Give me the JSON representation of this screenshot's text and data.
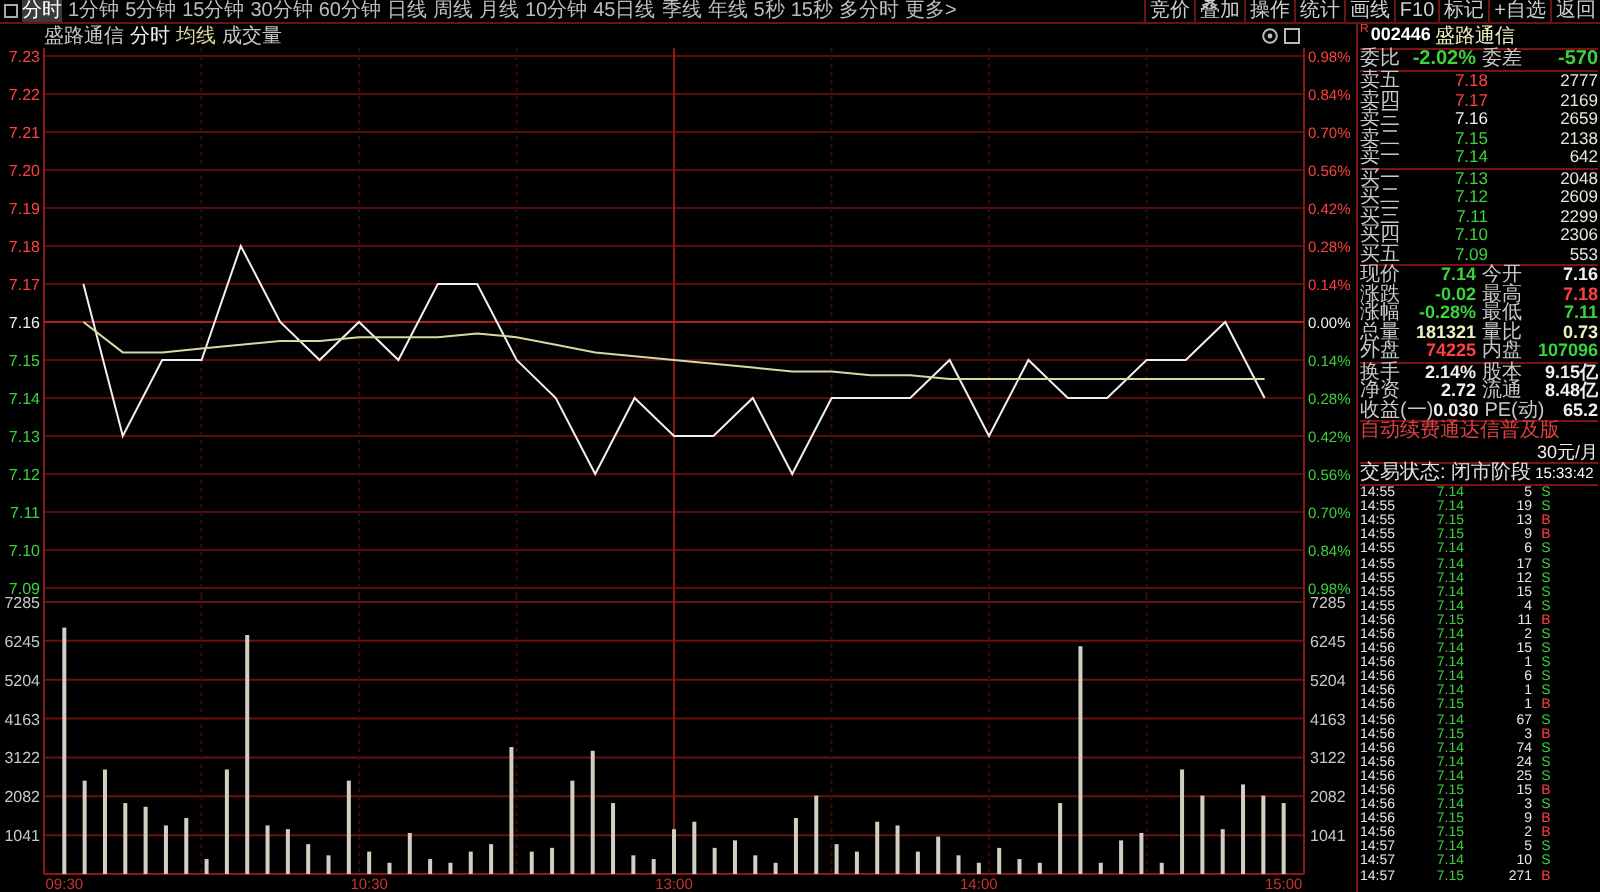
{
  "toolbar": {
    "periods": [
      {
        "label": "分时",
        "selected": true
      },
      {
        "label": "1分钟",
        "selected": false
      },
      {
        "label": "5分钟",
        "selected": false
      },
      {
        "label": "15分钟",
        "selected": false
      },
      {
        "label": "30分钟",
        "selected": false
      },
      {
        "label": "60分钟",
        "selected": false
      },
      {
        "label": "日线",
        "selected": false
      },
      {
        "label": "周线",
        "selected": false
      },
      {
        "label": "月线",
        "selected": false
      },
      {
        "label": "10分钟",
        "selected": false
      },
      {
        "label": "45日线",
        "selected": false
      },
      {
        "label": "季线",
        "selected": false
      },
      {
        "label": "年线",
        "selected": false
      },
      {
        "label": "5秒",
        "selected": false
      },
      {
        "label": "15秒",
        "selected": false
      },
      {
        "label": "多分时",
        "selected": false
      },
      {
        "label": "更多>",
        "selected": false
      }
    ],
    "actions": [
      "竞价",
      "叠加",
      "操作",
      "统计",
      "画线",
      "F10",
      "标记",
      "+自选",
      "返回"
    ]
  },
  "price_pane": {
    "title": "盛路通信",
    "percent_labels": [
      {
        "text": "0.98%",
        "kind": "up"
      },
      {
        "text": "0.84%",
        "kind": "up"
      },
      {
        "text": "0.70%",
        "kind": "up"
      },
      {
        "text": "0.56%",
        "kind": "up"
      },
      {
        "text": "0.42%",
        "kind": "up"
      },
      {
        "text": "0.28%",
        "kind": "up"
      },
      {
        "text": "0.14%",
        "kind": "up"
      },
      {
        "text": "0.00%",
        "kind": "flat"
      },
      {
        "text": "0.14%",
        "kind": "down"
      },
      {
        "text": "0.28%",
        "kind": "down"
      },
      {
        "text": "0.42%",
        "kind": "down"
      },
      {
        "text": "0.56%",
        "kind": "down"
      },
      {
        "text": "0.70%",
        "kind": "down"
      },
      {
        "text": "0.84%",
        "kind": "down"
      },
      {
        "text": "0.98%",
        "kind": "down"
      }
    ],
    "chart_data": {
      "type": "line",
      "grid": true,
      "categories": [
        null,
        null,
        null,
        null,
        null,
        null,
        null,
        null,
        null,
        null,
        null,
        null,
        null,
        null,
        null,
        null,
        null,
        null,
        null,
        null,
        null,
        null,
        null,
        null,
        null,
        null,
        null,
        null,
        null,
        null,
        null
      ],
      "ref_lines": [
        {
          "axis": "y",
          "value": 7.16
        }
      ],
      "series": [
        {
          "name": "分时",
          "color": "#f0f0f0",
          "values": [
            7.17,
            7.13,
            7.15,
            7.15,
            7.18,
            7.16,
            7.15,
            7.16,
            7.15,
            7.17,
            7.17,
            7.15,
            7.14,
            7.12,
            7.14,
            7.13,
            7.13,
            7.14,
            7.12,
            7.14,
            7.14,
            7.14,
            7.15,
            7.13,
            7.15,
            7.14,
            7.14,
            7.15,
            7.15,
            7.16,
            7.14
          ]
        },
        {
          "name": "均线",
          "color": "#d8d8a0",
          "values": [
            7.16,
            7.152,
            7.152,
            7.153,
            7.154,
            7.155,
            7.155,
            7.156,
            7.156,
            7.156,
            7.157,
            7.156,
            7.154,
            7.152,
            7.151,
            7.15,
            7.149,
            7.148,
            7.147,
            7.147,
            7.146,
            7.146,
            7.145,
            7.145,
            7.145,
            7.145,
            7.145,
            7.145,
            7.145,
            7.145,
            7.145
          ]
        }
      ],
      "ylim": [
        7.09,
        7.23
      ],
      "yticks": [
        {
          "value": 7.23,
          "label": "7.23"
        },
        {
          "value": 7.22,
          "label": "7.22"
        },
        {
          "value": 7.21,
          "label": "7.21"
        },
        {
          "value": 7.2,
          "label": "7.20"
        },
        {
          "value": 7.19,
          "label": "7.19"
        },
        {
          "value": 7.18,
          "label": "7.18"
        },
        {
          "value": 7.17,
          "label": "7.17"
        },
        {
          "value": 7.16,
          "label": "7.16"
        },
        {
          "value": 7.15,
          "label": "7.15"
        },
        {
          "value": 7.14,
          "label": "7.14"
        },
        {
          "value": 7.13,
          "label": "7.13"
        },
        {
          "value": 7.12,
          "label": "7.12"
        },
        {
          "value": 7.11,
          "label": "7.11"
        },
        {
          "value": 7.1,
          "label": "7.10"
        },
        {
          "value": 7.09,
          "label": "7.09"
        }
      ]
    }
  },
  "volume_pane": {
    "right_labels": [
      "7285",
      "6245",
      "5204",
      "4163",
      "3122",
      "2082",
      "1041"
    ],
    "chart_data": {
      "type": "bar",
      "grid": true,
      "categories": [
        "09:30",
        null,
        null,
        null,
        null,
        null,
        null,
        null,
        null,
        null,
        null,
        null,
        null,
        null,
        null,
        "10:30",
        null,
        null,
        null,
        null,
        null,
        null,
        null,
        null,
        null,
        null,
        null,
        null,
        null,
        null,
        "13:00",
        null,
        null,
        null,
        null,
        null,
        null,
        null,
        null,
        null,
        null,
        null,
        null,
        null,
        null,
        "14:00",
        null,
        null,
        null,
        null,
        null,
        null,
        null,
        null,
        null,
        null,
        null,
        null,
        null,
        null,
        "15:00"
      ],
      "series": [
        {
          "name": "成交量",
          "color": "#d0d0c0",
          "values": [
            6600,
            2500,
            2800,
            1900,
            1800,
            1300,
            1500,
            400,
            2800,
            6400,
            1300,
            1200,
            800,
            500,
            2500,
            600,
            300,
            1100,
            400,
            300,
            600,
            800,
            3400,
            600,
            700,
            2500,
            3300,
            1900,
            500,
            400,
            1200,
            1400,
            700,
            900,
            500,
            300,
            1500,
            2100,
            800,
            600,
            1400,
            1300,
            600,
            1000,
            500,
            300,
            700,
            400,
            300,
            1900,
            6100,
            300,
            900,
            1100,
            300,
            2800,
            2100,
            1200,
            2400,
            2100,
            1900
          ]
        }
      ],
      "ylim": [
        0,
        7285
      ],
      "yticks": [
        {
          "value": 7285,
          "label": "7285"
        },
        {
          "value": 6245,
          "label": "6245"
        },
        {
          "value": 5204,
          "label": "5204"
        },
        {
          "value": 4163,
          "label": "4163"
        },
        {
          "value": 3122,
          "label": "3122"
        },
        {
          "value": 2082,
          "label": "2082"
        },
        {
          "value": 1041,
          "label": "1041"
        }
      ]
    }
  },
  "quote": {
    "badge": "R",
    "code": "002446",
    "name": "盛路通信",
    "summary": [
      {
        "label": "委比",
        "value": "-2.02%"
      },
      {
        "label": "委差",
        "value": "-570"
      }
    ],
    "asks": [
      {
        "label": "卖五",
        "price": "7.18",
        "volume": "2777",
        "color": "#ff4040"
      },
      {
        "label": "卖四",
        "price": "7.17",
        "volume": "2169",
        "color": "#ff4040"
      },
      {
        "label": "卖三",
        "price": "7.16",
        "volume": "2659",
        "color": "#f0f0f0"
      },
      {
        "label": "卖二",
        "price": "7.15",
        "volume": "2138",
        "color": "#3cd23c"
      },
      {
        "label": "卖一",
        "price": "7.14",
        "volume": "642",
        "color": "#3cd23c"
      }
    ],
    "bids": [
      {
        "label": "买一",
        "price": "7.13",
        "volume": "2048",
        "color": "#3cd23c"
      },
      {
        "label": "买二",
        "price": "7.12",
        "volume": "2609",
        "color": "#3cd23c"
      },
      {
        "label": "买三",
        "price": "7.11",
        "volume": "2299",
        "color": "#3cd23c"
      },
      {
        "label": "买四",
        "price": "7.10",
        "volume": "2306",
        "color": "#3cd23c"
      },
      {
        "label": "买五",
        "price": "7.09",
        "volume": "553",
        "color": "#3cd23c"
      }
    ],
    "stats": [
      [
        {
          "label": "现价",
          "value": "7.14",
          "color": "#3cd23c"
        },
        {
          "label": "今开",
          "value": "7.16",
          "color": "#f0f0f0"
        }
      ],
      [
        {
          "label": "涨跌",
          "value": "-0.02",
          "color": "#3cd23c"
        },
        {
          "label": "最高",
          "value": "7.18",
          "color": "#ff4040"
        }
      ],
      [
        {
          "label": "涨幅",
          "value": "-0.28%",
          "color": "#3cd23c"
        },
        {
          "label": "最低",
          "value": "7.11",
          "color": "#3cd23c"
        }
      ],
      [
        {
          "label": "总量",
          "value": "181321",
          "color": "#f0f0c0"
        },
        {
          "label": "量比",
          "value": "0.73",
          "color": "#f0f0c0"
        }
      ],
      [
        {
          "label": "外盘",
          "value": "74225",
          "color": "#ff4040"
        },
        {
          "label": "内盘",
          "value": "107096",
          "color": "#3cd23c"
        }
      ]
    ],
    "fundamentals": [
      [
        {
          "label": "换手",
          "value": "2.14%",
          "color": "#f0f0f0"
        },
        {
          "label": "股本",
          "value": "9.15亿",
          "color": "#f0f0f0"
        }
      ],
      [
        {
          "label": "净资",
          "value": "2.72",
          "color": "#f0f0f0"
        },
        {
          "label": "流通",
          "value": "8.48亿",
          "color": "#f0f0f0"
        }
      ],
      [
        {
          "label": "收益(一)",
          "value": "0.030",
          "color": "#f0f0f0"
        },
        {
          "label": "PE(动)",
          "value": "65.2",
          "color": "#f0f0f0"
        }
      ]
    ],
    "promo": {
      "text": "自动续费通达信普及版",
      "price": "30元/月"
    },
    "status": {
      "label": "交易状态: 闭市阶段",
      "time": "15:33:42"
    },
    "trades": [
      {
        "time": "14:55",
        "price": "7.14",
        "volume": "5",
        "side": "S",
        "kind": "sell"
      },
      {
        "time": "14:55",
        "price": "7.14",
        "volume": "19",
        "side": "S",
        "kind": "sell"
      },
      {
        "time": "14:55",
        "price": "7.15",
        "volume": "13",
        "side": "B",
        "kind": "buy"
      },
      {
        "time": "14:55",
        "price": "7.15",
        "volume": "9",
        "side": "B",
        "kind": "buy"
      },
      {
        "time": "14:55",
        "price": "7.14",
        "volume": "6",
        "side": "S",
        "kind": "sell"
      },
      {
        "time": "14:55",
        "price": "7.14",
        "volume": "17",
        "side": "S",
        "kind": "sell"
      },
      {
        "time": "14:55",
        "price": "7.14",
        "volume": "12",
        "side": "S",
        "kind": "sell"
      },
      {
        "time": "14:55",
        "price": "7.14",
        "volume": "15",
        "side": "S",
        "kind": "sell"
      },
      {
        "time": "14:55",
        "price": "7.14",
        "volume": "4",
        "side": "S",
        "kind": "sell"
      },
      {
        "time": "14:56",
        "price": "7.15",
        "volume": "11",
        "side": "B",
        "kind": "buy"
      },
      {
        "time": "14:56",
        "price": "7.14",
        "volume": "2",
        "side": "S",
        "kind": "sell"
      },
      {
        "time": "14:56",
        "price": "7.14",
        "volume": "15",
        "side": "S",
        "kind": "sell"
      },
      {
        "time": "14:56",
        "price": "7.14",
        "volume": "1",
        "side": "S",
        "kind": "sell"
      },
      {
        "time": "14:56",
        "price": "7.14",
        "volume": "6",
        "side": "S",
        "kind": "sell"
      },
      {
        "time": "14:56",
        "price": "7.14",
        "volume": "1",
        "side": "S",
        "kind": "sell"
      },
      {
        "time": "14:56",
        "price": "7.15",
        "volume": "1",
        "side": "B",
        "kind": "buy"
      },
      {
        "time": "14:56",
        "price": "7.14",
        "volume": "67",
        "side": "S",
        "kind": "sell"
      },
      {
        "time": "14:56",
        "price": "7.15",
        "volume": "3",
        "side": "B",
        "kind": "buy"
      },
      {
        "time": "14:56",
        "price": "7.14",
        "volume": "74",
        "side": "S",
        "kind": "sell"
      },
      {
        "time": "14:56",
        "price": "7.14",
        "volume": "24",
        "side": "S",
        "kind": "sell"
      },
      {
        "time": "14:56",
        "price": "7.14",
        "volume": "25",
        "side": "S",
        "kind": "sell"
      },
      {
        "time": "14:56",
        "price": "7.15",
        "volume": "15",
        "side": "B",
        "kind": "buy"
      },
      {
        "time": "14:56",
        "price": "7.14",
        "volume": "3",
        "side": "S",
        "kind": "sell"
      },
      {
        "time": "14:56",
        "price": "7.15",
        "volume": "9",
        "side": "B",
        "kind": "buy"
      },
      {
        "time": "14:56",
        "price": "7.15",
        "volume": "2",
        "side": "B",
        "kind": "buy"
      },
      {
        "time": "14:57",
        "price": "7.14",
        "volume": "5",
        "side": "S",
        "kind": "sell"
      },
      {
        "time": "14:57",
        "price": "7.14",
        "volume": "10",
        "side": "S",
        "kind": "sell"
      },
      {
        "time": "14:57",
        "price": "7.15",
        "volume": "271",
        "side": "B",
        "kind": "buy"
      }
    ]
  }
}
